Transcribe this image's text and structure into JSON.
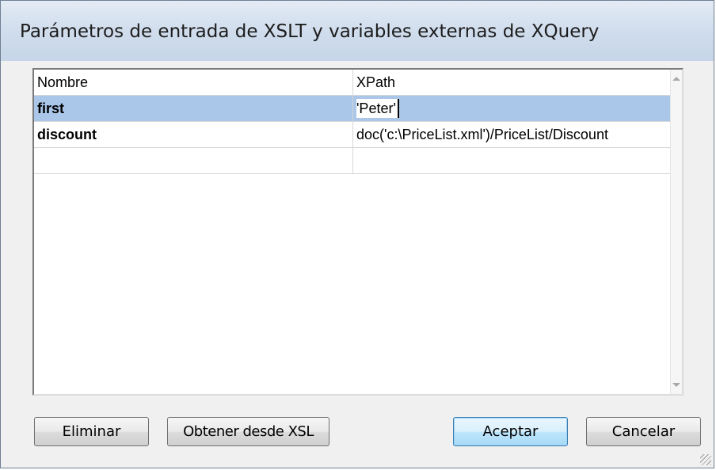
{
  "window": {
    "title": "Parámetros de entrada de XSLT y variables externas de XQuery"
  },
  "grid": {
    "columns": [
      "Nombre",
      "XPath"
    ],
    "rows": [
      {
        "name": "first",
        "xpath": "'Peter'",
        "selected": true
      },
      {
        "name": "discount",
        "xpath": "doc('c:\\PriceList.xml')/PriceList/Discount",
        "selected": false
      },
      {
        "name": "",
        "xpath": "",
        "selected": false
      }
    ]
  },
  "buttons": {
    "delete": "Eliminar",
    "get_from_xsl": "Obtener desde XSL",
    "accept": "Aceptar",
    "cancel": "Cancelar"
  },
  "icons": {
    "scroll_up": "scroll-up-arrow-icon",
    "scroll_down": "scroll-down-arrow-icon",
    "resize_grip": "resize-grip-icon"
  },
  "colors": {
    "selection": "#aac6e8",
    "title_gradient_top": "#e3ebf5",
    "title_gradient_bottom": "#c6d5e8",
    "default_button_border": "#3c7fb1"
  }
}
